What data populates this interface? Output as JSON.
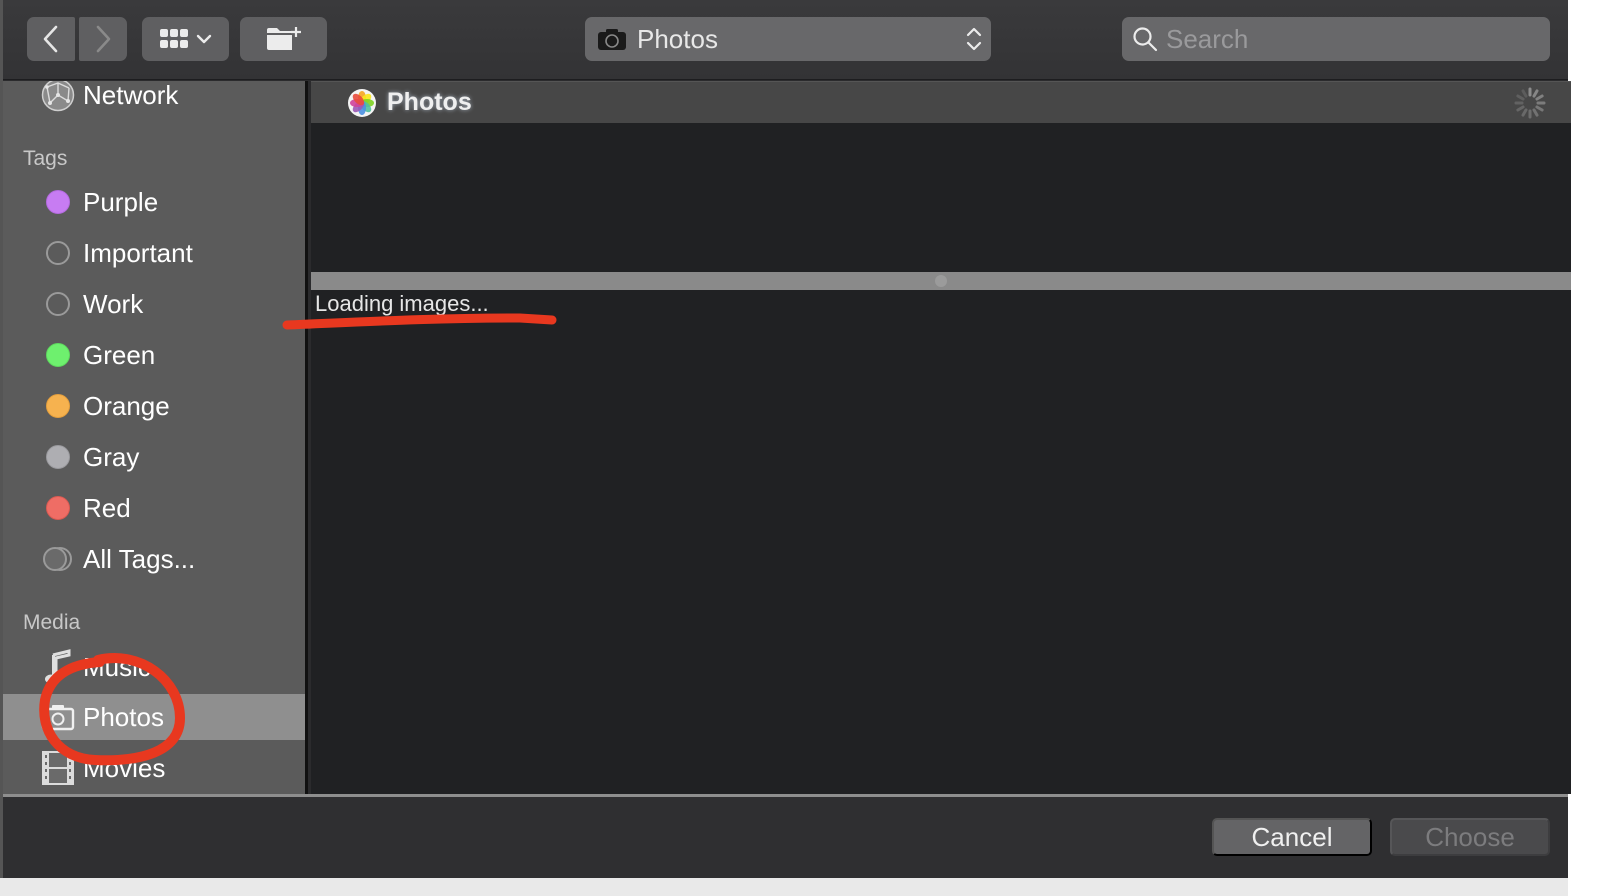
{
  "toolbar": {
    "back_icon": "chevron-left-icon",
    "forward_icon": "chevron-right-icon",
    "view_icon": "grid-view-icon",
    "new_folder_icon": "new-folder-icon",
    "location": {
      "icon": "camera-icon",
      "selected": "Photos"
    },
    "search": {
      "placeholder": "Search",
      "value": ""
    }
  },
  "sidebar": {
    "top_item": {
      "label": "Network",
      "icon": "network-globe-icon"
    },
    "tags_header": "Tags",
    "tags": [
      {
        "label": "Purple",
        "color": "#c77cf2",
        "filled": true
      },
      {
        "label": "Important",
        "color": "",
        "filled": false
      },
      {
        "label": "Work",
        "color": "",
        "filled": false
      },
      {
        "label": "Green",
        "color": "#6ef06e",
        "filled": true
      },
      {
        "label": "Orange",
        "color": "#f6b24f",
        "filled": true
      },
      {
        "label": "Gray",
        "color": "#aeaeb2",
        "filled": true
      },
      {
        "label": "Red",
        "color": "#ef6d65",
        "filled": true
      }
    ],
    "all_tags_label": "All Tags...",
    "media_header": "Media",
    "media": [
      {
        "label": "Music",
        "icon": "music-note-icon",
        "selected": false
      },
      {
        "label": "Photos",
        "icon": "camera-icon",
        "selected": true
      },
      {
        "label": "Movies",
        "icon": "film-icon",
        "selected": false
      }
    ]
  },
  "main": {
    "header_title": "Photos",
    "header_icon": "photos-app-icon",
    "status_icon": "loading-spinner-icon",
    "loading_text": "Loading images..."
  },
  "footer": {
    "cancel_label": "Cancel",
    "choose_label": "Choose",
    "choose_enabled": false
  },
  "annotations": {
    "color": "#e8381f",
    "items": [
      "underline under loading text",
      "circle around Photos sidebar item"
    ]
  }
}
